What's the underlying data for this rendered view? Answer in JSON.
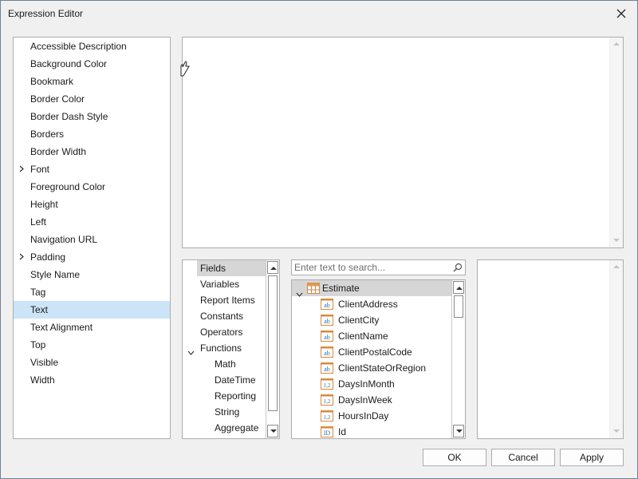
{
  "window": {
    "title": "Expression Editor"
  },
  "properties": [
    {
      "label": "Accessible Description",
      "expandable": false,
      "selected": false
    },
    {
      "label": "Background Color",
      "expandable": false,
      "selected": false
    },
    {
      "label": "Bookmark",
      "expandable": false,
      "selected": false
    },
    {
      "label": "Border Color",
      "expandable": false,
      "selected": false
    },
    {
      "label": "Border Dash Style",
      "expandable": false,
      "selected": false
    },
    {
      "label": "Borders",
      "expandable": false,
      "selected": false
    },
    {
      "label": "Border Width",
      "expandable": false,
      "selected": false
    },
    {
      "label": "Font",
      "expandable": true,
      "selected": false
    },
    {
      "label": "Foreground Color",
      "expandable": false,
      "selected": false
    },
    {
      "label": "Height",
      "expandable": false,
      "selected": false
    },
    {
      "label": "Left",
      "expandable": false,
      "selected": false
    },
    {
      "label": "Navigation URL",
      "expandable": false,
      "selected": false
    },
    {
      "label": "Padding",
      "expandable": true,
      "selected": false
    },
    {
      "label": "Style Name",
      "expandable": false,
      "selected": false
    },
    {
      "label": "Tag",
      "expandable": false,
      "selected": false
    },
    {
      "label": "Text",
      "expandable": false,
      "selected": true
    },
    {
      "label": "Text Alignment",
      "expandable": false,
      "selected": false
    },
    {
      "label": "Top",
      "expandable": false,
      "selected": false
    },
    {
      "label": "Visible",
      "expandable": false,
      "selected": false
    },
    {
      "label": "Width",
      "expandable": false,
      "selected": false
    }
  ],
  "categories": [
    {
      "label": "Fields",
      "level": 0,
      "selected": true,
      "expanded": null
    },
    {
      "label": "Variables",
      "level": 0,
      "selected": false,
      "expanded": null
    },
    {
      "label": "Report Items",
      "level": 0,
      "selected": false,
      "expanded": null
    },
    {
      "label": "Constants",
      "level": 0,
      "selected": false,
      "expanded": null
    },
    {
      "label": "Operators",
      "level": 0,
      "selected": false,
      "expanded": null
    },
    {
      "label": "Functions",
      "level": 0,
      "selected": false,
      "expanded": true
    },
    {
      "label": "Math",
      "level": 1,
      "selected": false,
      "expanded": null
    },
    {
      "label": "DateTime",
      "level": 1,
      "selected": false,
      "expanded": null
    },
    {
      "label": "Reporting",
      "level": 1,
      "selected": false,
      "expanded": null
    },
    {
      "label": "String",
      "level": 1,
      "selected": false,
      "expanded": null
    },
    {
      "label": "Aggregate",
      "level": 1,
      "selected": false,
      "expanded": null
    }
  ],
  "search": {
    "placeholder": "Enter text to search..."
  },
  "fields": {
    "root": {
      "label": "Estimate",
      "icon": "table-icon"
    },
    "items": [
      {
        "label": "ClientAddress",
        "icon": "string-field-icon",
        "glyph": "ab"
      },
      {
        "label": "ClientCity",
        "icon": "string-field-icon",
        "glyph": "ab"
      },
      {
        "label": "ClientName",
        "icon": "string-field-icon",
        "glyph": "ab"
      },
      {
        "label": "ClientPostalCode",
        "icon": "string-field-icon",
        "glyph": "ab"
      },
      {
        "label": "ClientStateOrRegion",
        "icon": "string-field-icon",
        "glyph": "ab"
      },
      {
        "label": "DaysInMonth",
        "icon": "number-field-icon",
        "glyph": "1,2"
      },
      {
        "label": "DaysInWeek",
        "icon": "number-field-icon",
        "glyph": "1,2"
      },
      {
        "label": "HoursInDay",
        "icon": "number-field-icon",
        "glyph": "1,2"
      },
      {
        "label": "Id",
        "icon": "id-field-icon",
        "glyph": "ID"
      }
    ]
  },
  "buttons": {
    "ok": "OK",
    "cancel": "Cancel",
    "apply": "Apply"
  },
  "colors": {
    "selection": "#cce4f7",
    "tree_selection": "#d6d6d6",
    "field_icon": "#d98a3a",
    "field_icon_text": "#2b6cb0"
  }
}
